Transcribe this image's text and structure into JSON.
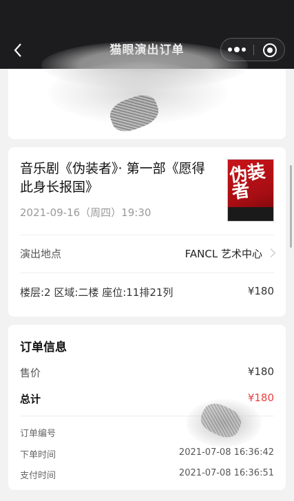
{
  "header": {
    "title": "猫眼演出订单",
    "back_icon": "back-arrow-icon",
    "more_icon": "more-dots-icon",
    "close_icon": "target-close-icon"
  },
  "show": {
    "title": "音乐剧《伪装者》· 第一部《愿得此身长报国》",
    "datetime": "2021-09-16（周四）19:30",
    "poster_text": "伪装者",
    "venue_label": "演出地点",
    "venue_value": "FANCL 艺术中心",
    "seat_info": "楼层:2 区域:二楼 座位:11排21列",
    "seat_price": "¥180"
  },
  "order": {
    "section_title": "订单信息",
    "price_label": "售价",
    "price_value": "¥180",
    "total_label": "总计",
    "total_value": "¥180",
    "order_no_label": "订单编号",
    "order_time_label": "下单时间",
    "order_time_value": "2021-07-08 16:36:42",
    "pay_time_label": "支付时间",
    "pay_time_value": "2021-07-08 16:36:51"
  },
  "colors": {
    "header_bg": "#1c1c1e",
    "page_bg": "#f2f2f2",
    "accent_red": "#e84040"
  }
}
